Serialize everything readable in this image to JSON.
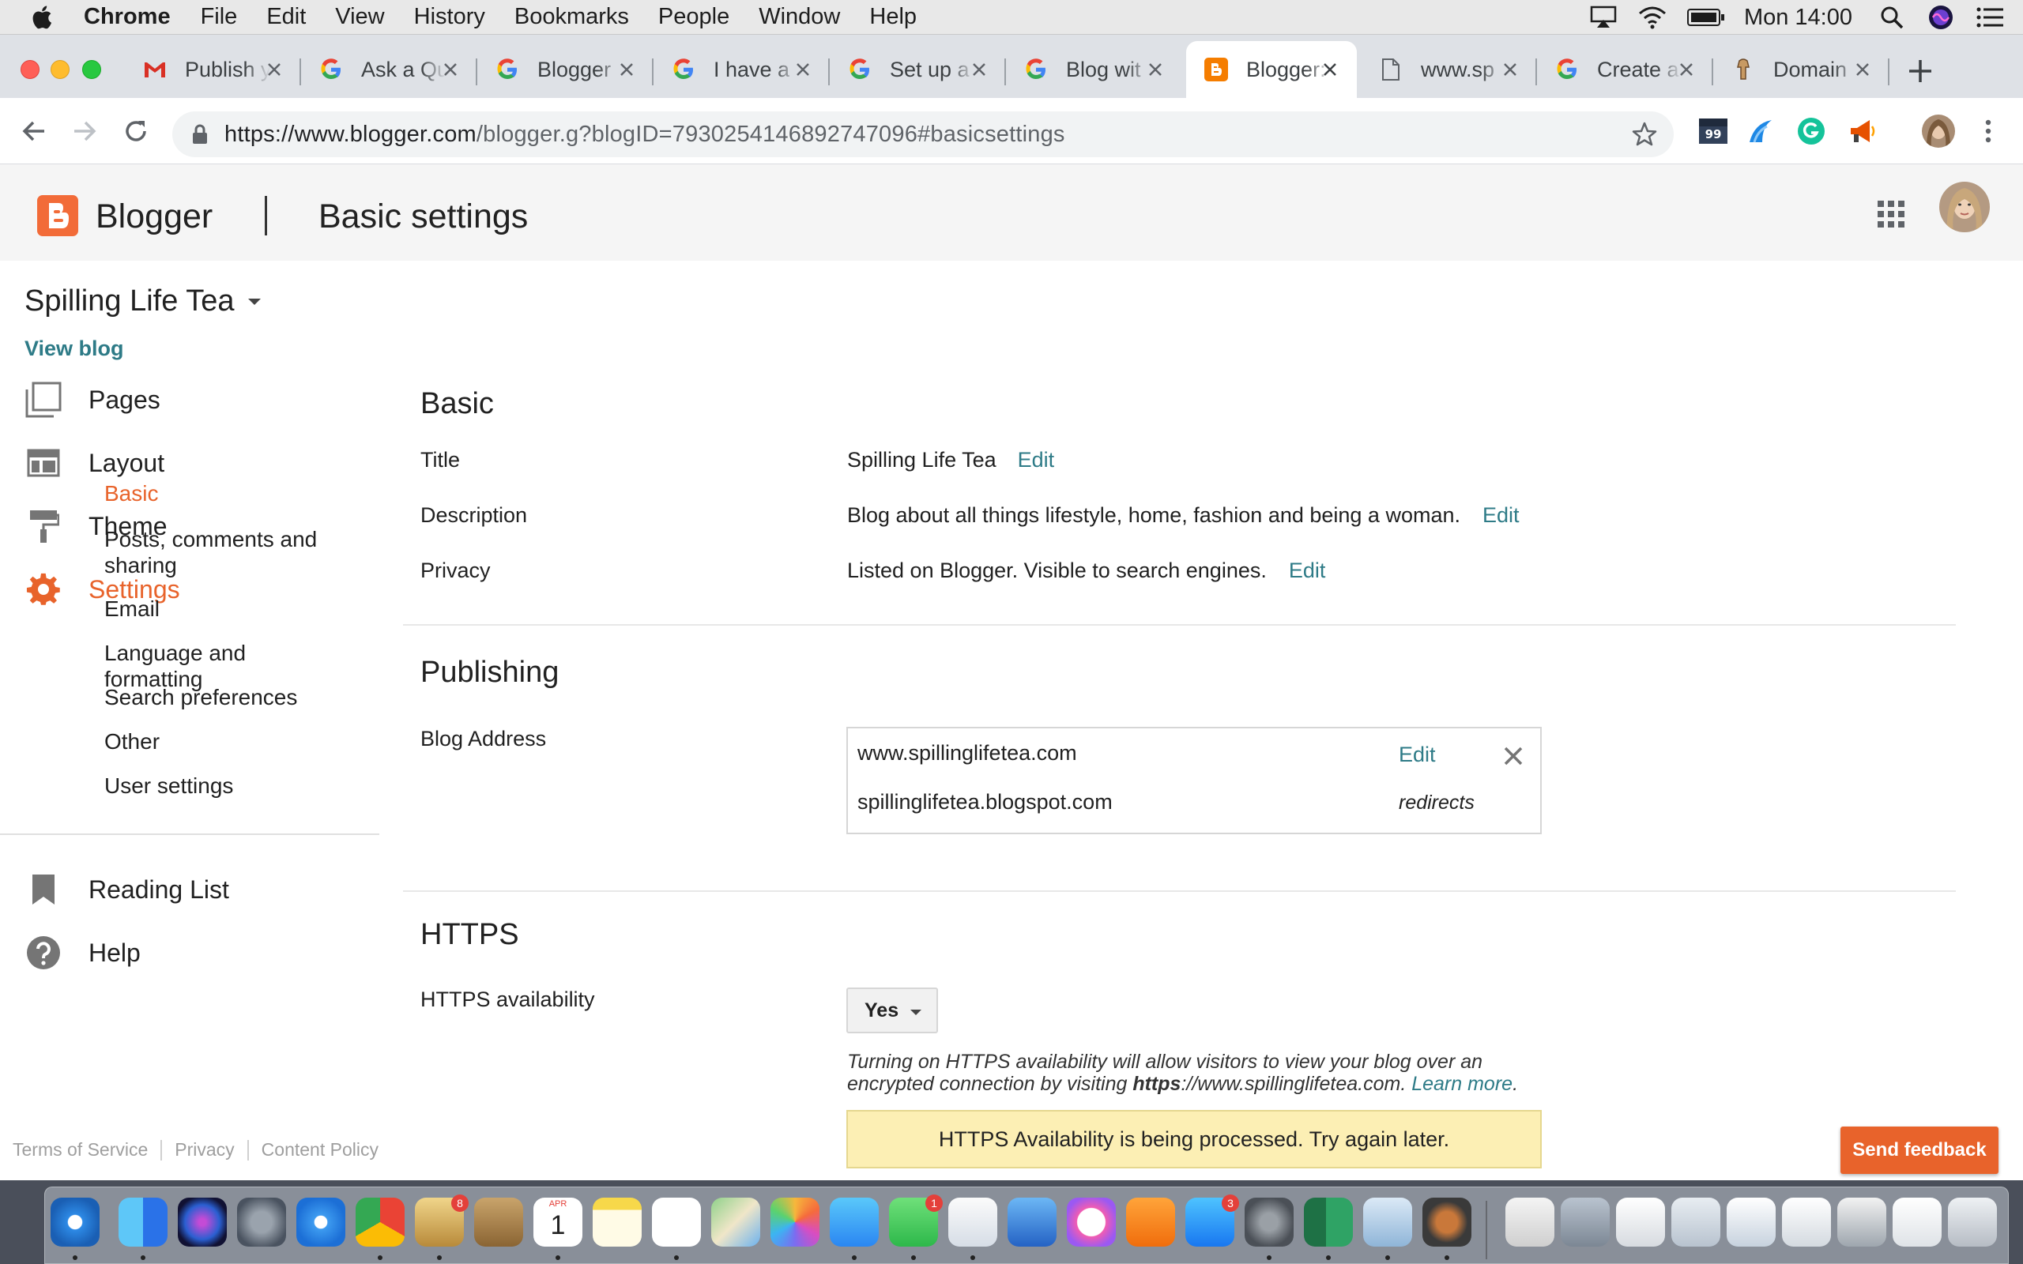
{
  "menubar": {
    "app_name": "Chrome",
    "items": [
      "File",
      "Edit",
      "View",
      "History",
      "Bookmarks",
      "People",
      "Window",
      "Help"
    ],
    "clock": "Mon 14:00"
  },
  "tabs": [
    {
      "title": "Publish y",
      "icon": "gmail-icon"
    },
    {
      "title": "Ask a Qu",
      "icon": "google-icon"
    },
    {
      "title": "Blogger",
      "icon": "google-icon"
    },
    {
      "title": "I have a",
      "icon": "google-icon"
    },
    {
      "title": "Set up a",
      "icon": "google-icon"
    },
    {
      "title": "Blog wit",
      "icon": "google-icon"
    },
    {
      "title": "Blogger:",
      "icon": "blogger-icon",
      "active": true
    },
    {
      "title": "www.sp",
      "icon": "page-icon"
    },
    {
      "title": "Create a",
      "icon": "google-icon"
    },
    {
      "title": "Domain",
      "icon": "domain-icon"
    }
  ],
  "omnibox": {
    "url_host": "https://www.blogger.com",
    "url_path": "/blogger.g?blogID=7930254146892747096#basicsettings"
  },
  "appbar": {
    "brand": "Blogger",
    "page_title": "Basic settings"
  },
  "sidebar": {
    "blog_name": "Spilling Life Tea",
    "view_blog": "View blog",
    "nav": {
      "pages": "Pages",
      "layout": "Layout",
      "theme": "Theme",
      "settings": "Settings",
      "reading_list": "Reading List",
      "help": "Help"
    },
    "settings_sub": {
      "basic": "Basic",
      "posts": "Posts, comments and sharing",
      "email": "Email",
      "language": "Language and formatting",
      "search": "Search preferences",
      "other": "Other",
      "user": "User settings"
    },
    "footer": {
      "terms": "Terms of Service",
      "privacy": "Privacy",
      "content_policy": "Content Policy"
    }
  },
  "basic": {
    "heading": "Basic",
    "title_label": "Title",
    "title_value": "Spilling Life Tea",
    "description_label": "Description",
    "description_value": "Blog about all things lifestyle, home, fashion and being a woman.",
    "privacy_label": "Privacy",
    "privacy_value": "Listed on Blogger. Visible to search engines.",
    "edit_label": "Edit"
  },
  "publishing": {
    "heading": "Publishing",
    "blog_address_label": "Blog Address",
    "custom_domain": "www.spillinglifetea.com",
    "blogspot_domain": "spillinglifetea.blogspot.com",
    "edit_label": "Edit",
    "redirects_label": "redirects"
  },
  "https": {
    "heading": "HTTPS",
    "availability_label": "HTTPS availability",
    "selected": "Yes",
    "help_text": "Turning on HTTPS availability will allow visitors to view your blog over an encrypted connection by visiting ",
    "help_url_bold": "https",
    "help_url_rest": "://www.spillinglifetea.com.",
    "learn_more": "Learn more",
    "notice": "HTTPS Availability is being processed. Try again later."
  },
  "feedback_button": "Send feedback",
  "dock": {
    "badges": {
      "mail": "8",
      "facetime": "1",
      "appstore": "3"
    },
    "calendar_month": "APR",
    "calendar_day": "1"
  },
  "colors": {
    "blogger_orange": "#e8632b",
    "link_teal": "#2e7b87",
    "notice_yellow": "#fcefb4"
  }
}
